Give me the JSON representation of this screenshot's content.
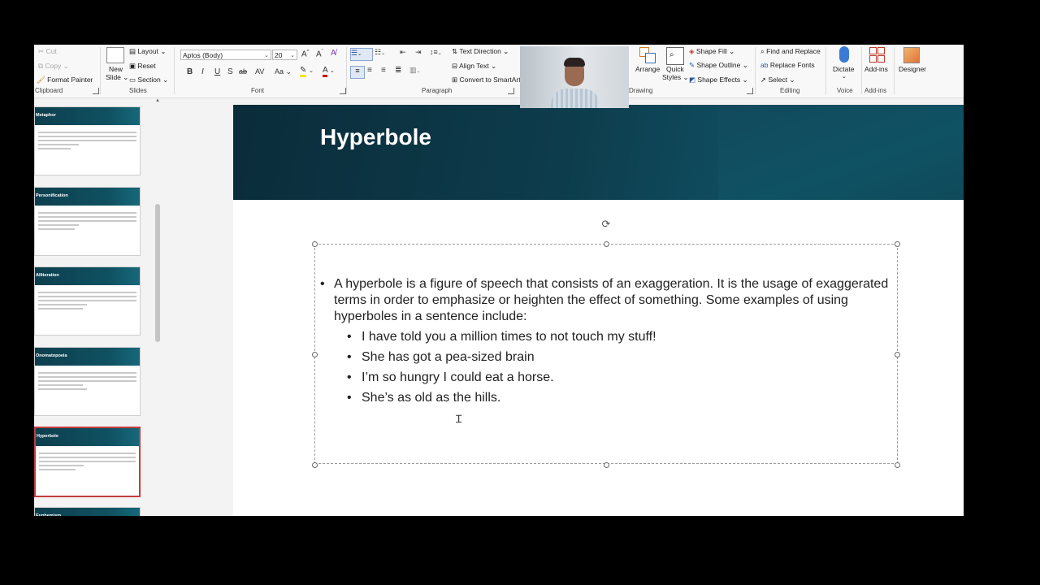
{
  "ribbon": {
    "clipboard": {
      "cut": "Cut",
      "copy": "Copy",
      "format_painter": "Format Painter",
      "label": "Clipboard"
    },
    "slides": {
      "new_slide": "New",
      "new_slide2": "Slide",
      "layout": "Layout",
      "reset": "Reset",
      "section": "Section",
      "label": "Slides"
    },
    "font": {
      "font_name": "Aptos (Body)",
      "font_size": "20",
      "bold": "B",
      "italic": "I",
      "underline": "U",
      "strike": "S",
      "strikethrough": "ab",
      "spacing": "AV",
      "change_case": "Aa",
      "highlight": "A",
      "font_color": "A",
      "label": "Font"
    },
    "paragraph": {
      "text_direction": "Text Direction",
      "align_text": "Align Text",
      "convert_smartart": "Convert to SmartArt",
      "label": "Paragraph"
    },
    "drawing": {
      "arrange": "Arrange",
      "quick_styles": "Quick",
      "quick_styles2": "Styles",
      "shape_fill": "Shape Fill",
      "shape_outline": "Shape Outline",
      "shape_effects": "Shape Effects",
      "label": "Drawing"
    },
    "editing": {
      "find_replace": "Find and Replace",
      "replace_fonts": "Replace Fonts",
      "select": "Select",
      "label": "Editing"
    },
    "voice": {
      "dictate": "Dictate",
      "label": "Voice"
    },
    "addins": {
      "addins": "Add-ins",
      "label": "Add-ins"
    },
    "designer": {
      "designer": "Designer"
    }
  },
  "thumbnails": [
    {
      "title": "Metaphor"
    },
    {
      "title": "Personification"
    },
    {
      "title": "Alliteration"
    },
    {
      "title": "Onomatopoeia"
    },
    {
      "title": "Hyperbole",
      "selected": true
    },
    {
      "title": "Euphemism"
    }
  ],
  "slide": {
    "title": "Hyperbole",
    "main_bullet": "A hyperbole is a figure of speech that consists of an exaggeration. It is the usage of exaggerated terms in order to emphasize or heighten the effect of something. Some examples of using hyperboles in a sentence include:",
    "sub_bullets": [
      "I have told you a million times to not touch my stuff!",
      "She has got a pea-sized brain",
      "I’m so hungry I could eat a horse.",
      "She’s as old as the hills."
    ]
  },
  "colors": {
    "banner": "#0d3c4c",
    "selected_border": "#c43e3e",
    "accent": "#2b579a"
  }
}
